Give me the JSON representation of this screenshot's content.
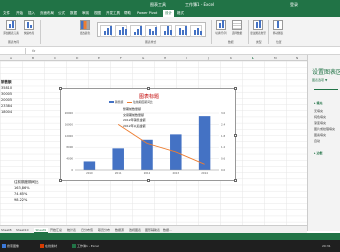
{
  "window": {
    "title": "工作簿1 - Excel",
    "context_label": "图表工具",
    "right_label": "登录"
  },
  "ribbon_tabs": [
    "文件",
    "开始",
    "插入",
    "页面布局",
    "公式",
    "数据",
    "审阅",
    "视图",
    "开发工具",
    "帮助",
    "Power Pivot",
    "设计",
    "格式"
  ],
  "ribbon": {
    "active_tab_label": "设计",
    "groups": [
      "图表布局",
      "图表样式",
      "数据",
      "类型",
      "位置"
    ],
    "buttons": [
      "添加图表元素",
      "快速布局",
      "更改颜色",
      "切换行/列",
      "选择数据",
      "更改图表类型",
      "移动图表"
    ]
  },
  "formula_bar": {
    "fx": "fx"
  },
  "columns": [
    "A",
    "B",
    "C",
    "D",
    "E",
    "F",
    "G",
    "H",
    "I",
    "J",
    "K",
    "L",
    "M",
    "N"
  ],
  "cells_left": [
    "销售额",
    "35810",
    "30005",
    "20005",
    "23384",
    "18004"
  ],
  "cells_lower": [
    "往前期度期间比",
    "163,86%",
    "74.65%",
    "98.22%"
  ],
  "chart": {
    "title": "图表标题",
    "legend": [
      "销售额",
      "往前期度期间比"
    ],
    "table_rows": [
      "整期前数量额",
      "交易期前数量额",
      "2012年销售金额",
      "2012年以后金额"
    ],
    "chart_data": {
      "type": "bar",
      "categories": [
        "2010",
        "2011",
        "2012",
        "2013",
        "2014"
      ],
      "series": [
        {
          "name": "销售额",
          "type": "bar",
          "values": [
            3000,
            7600,
            10600,
            12500,
            18900
          ]
        },
        {
          "name": "往前期度期间比",
          "type": "line",
          "values": [
            null,
            2.4,
            1.4,
            0.95,
            0.3
          ]
        }
      ],
      "ylim": [
        0,
        20000
      ],
      "y2lim": [
        0,
        3
      ]
    }
  },
  "pane": {
    "title": "设置图表区",
    "subtitle": "图表选项 ▼",
    "items": [
      "▸ 填充",
      "无填充",
      "纯色填充",
      "渐变填充",
      "图片或纹理填充",
      "图案填充",
      "自动",
      "▸ 边框"
    ]
  },
  "sheet_tabs": [
    "Sheet8",
    "Sheet10",
    "Sheet9",
    "开始汇总",
    "统计表",
    "日分布值",
    "职员分布",
    "数据源",
    "透视图表",
    "图形辅助表",
    "数据..."
  ],
  "active_sheet": "Sheet9",
  "taskbar": {
    "items": [
      "搜索图像",
      "在线素材",
      "工作簿1 - Excel"
    ],
    "time": "20:31"
  },
  "colors": {
    "excel_green": "#217346",
    "bar": "#4472c4",
    "line": "#ed7d31",
    "title_red": "#c00000"
  }
}
